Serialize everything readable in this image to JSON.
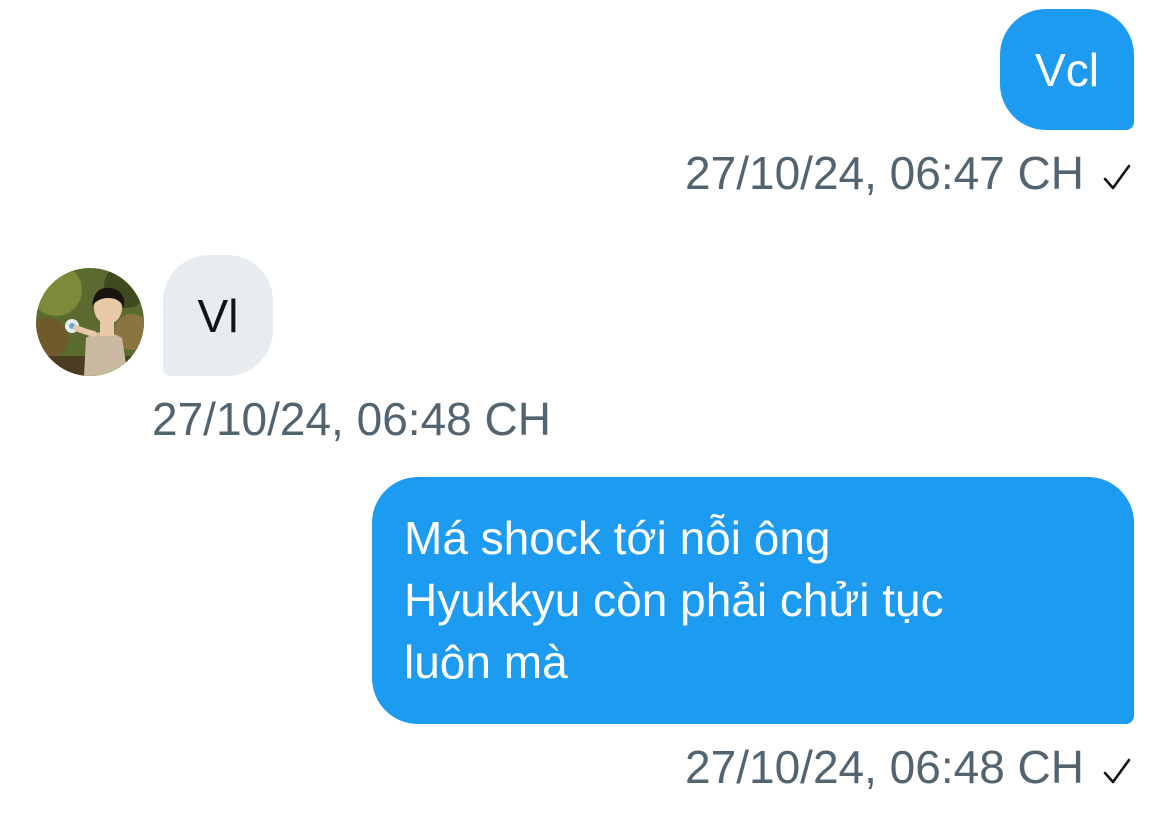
{
  "colors": {
    "outgoing_bubble": "#1d9bf0",
    "incoming_bubble": "#e7ecf0",
    "timestamp_text": "#536471"
  },
  "messages": [
    {
      "direction": "outgoing",
      "text": "Vcl",
      "timestamp": "27/10/24, 06:47 CH",
      "status_icon": "checkmark-icon"
    },
    {
      "direction": "incoming",
      "text": "Vl",
      "timestamp": "27/10/24, 06:48 CH",
      "avatar_icon": "user-avatar"
    },
    {
      "direction": "outgoing",
      "text_lines": [
        "Má shock tới nỗi ông",
        "Hyukkyu còn phải chửi tục",
        "luôn mà"
      ],
      "timestamp": "27/10/24, 06:48 CH",
      "status_icon": "checkmark-icon"
    }
  ]
}
